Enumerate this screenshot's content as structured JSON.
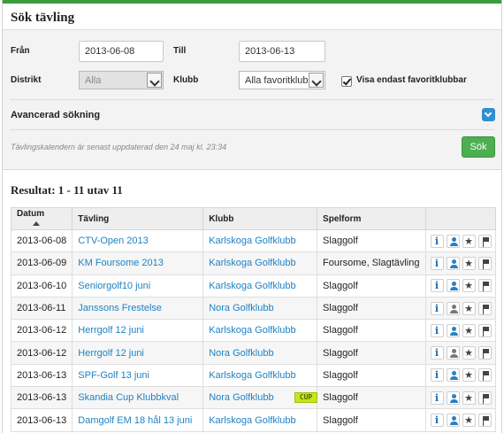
{
  "page": {
    "title": "Sök tävling",
    "accent_color": "#3a9c3c"
  },
  "search": {
    "from_label": "Från",
    "from_value": "2013-06-08",
    "to_label": "Till",
    "to_value": "2013-06-13",
    "district_label": "Distrikt",
    "district_value": "Alla",
    "club_label": "Klubb",
    "club_value": "Alla favoritklubba",
    "favorites_only_label": "Visa endast favoritklubbar",
    "favorites_only_checked": true,
    "advanced_label": "Avancerad sökning",
    "updated_text": "Tävlingskalendern är senast uppdaterad den 24 maj kl. 23:34",
    "search_button": "Sök",
    "search_button_color": "#4caf50"
  },
  "results": {
    "title": "Resultat: 1 - 11 utav 11",
    "columns": [
      "Datum",
      "Tävling",
      "Klubb",
      "Spelform"
    ],
    "rows": [
      {
        "date": "2013-06-08",
        "name": "CTV-Open 2013",
        "club": "Karlskoga Golfklubb",
        "form": "Slaggolf",
        "user_icon": "blue"
      },
      {
        "date": "2013-06-09",
        "name": "KM Foursome 2013",
        "club": "Karlskoga Golfklubb",
        "form": "Foursome, Slagtävling",
        "user_icon": "blue"
      },
      {
        "date": "2013-06-10",
        "name": "Seniorgolf10 juni",
        "club": "Karlskoga Golfklubb",
        "form": "Slaggolf",
        "user_icon": "blue"
      },
      {
        "date": "2013-06-11",
        "name": "Janssons Frestelse",
        "club": "Nora Golfklubb",
        "form": "Slaggolf",
        "user_icon": "grey"
      },
      {
        "date": "2013-06-12",
        "name": "Herrgolf 12 juni",
        "club": "Karlskoga Golfklubb",
        "form": "Slaggolf",
        "user_icon": "blue"
      },
      {
        "date": "2013-06-12",
        "name": "Herrgolf 12 juni",
        "club": "Nora Golfklubb",
        "form": "Slaggolf",
        "user_icon": "grey"
      },
      {
        "date": "2013-06-13",
        "name": "SPF-Golf 13 juni",
        "club": "Karlskoga Golfklubb",
        "form": "Slaggolf",
        "user_icon": "blue"
      },
      {
        "date": "2013-06-13",
        "name": "Skandia Cup Klubbkval",
        "club": "Nora Golfklubb",
        "form": "Slaggolf",
        "user_icon": "blue"
      },
      {
        "date": "2013-06-13",
        "name": "Damgolf EM 18 hål 13 juni",
        "club": "Karlskoga Golfklubb",
        "form": "Slaggolf",
        "user_icon": "blue"
      }
    ],
    "row_icons": [
      "info-icon",
      "user-icon",
      "star-icon",
      "flag-icon"
    ],
    "cup_badge": "CUP"
  }
}
